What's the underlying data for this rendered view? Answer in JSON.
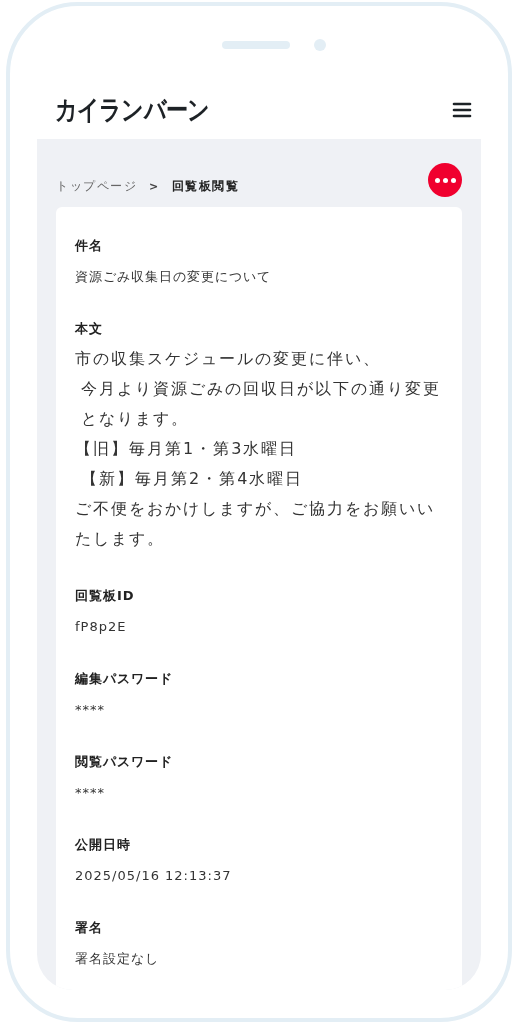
{
  "header": {
    "logo": "カイランバーン"
  },
  "breadcrumb": {
    "separator": ">",
    "items": [
      {
        "label": "トップページ",
        "current": false
      },
      {
        "label": "回覧板閲覧",
        "current": true
      }
    ]
  },
  "fields": [
    {
      "kind": "single",
      "label": "件名",
      "value": "資源ごみ収集日の変更について"
    },
    {
      "kind": "multiline",
      "label": "本文",
      "lines": [
        {
          "text": "市の収集スケジュールの変更に伴い、",
          "indent": false
        },
        {
          "text": "今月より資源ごみの回収日が以下の通り変更となります。",
          "indent": true
        },
        {
          "text": "【旧】毎月第1・第3水曜日",
          "indent": false
        },
        {
          "text": "【新】毎月第2・第4水曜日",
          "indent": true
        },
        {
          "text": "ご不便をおかけしますが、ご協力をお願いいたします。",
          "indent": false
        }
      ]
    },
    {
      "kind": "single",
      "label": "回覧板ID",
      "value": "fP8p2E"
    },
    {
      "kind": "single",
      "label": "編集パスワード",
      "value": "****"
    },
    {
      "kind": "single",
      "label": "閲覧パスワード",
      "value": "****"
    },
    {
      "kind": "single",
      "label": "公開日時",
      "value": "2025/05/16 12:13:37"
    },
    {
      "kind": "single",
      "label": "署名",
      "value": "署名設定なし"
    }
  ]
}
